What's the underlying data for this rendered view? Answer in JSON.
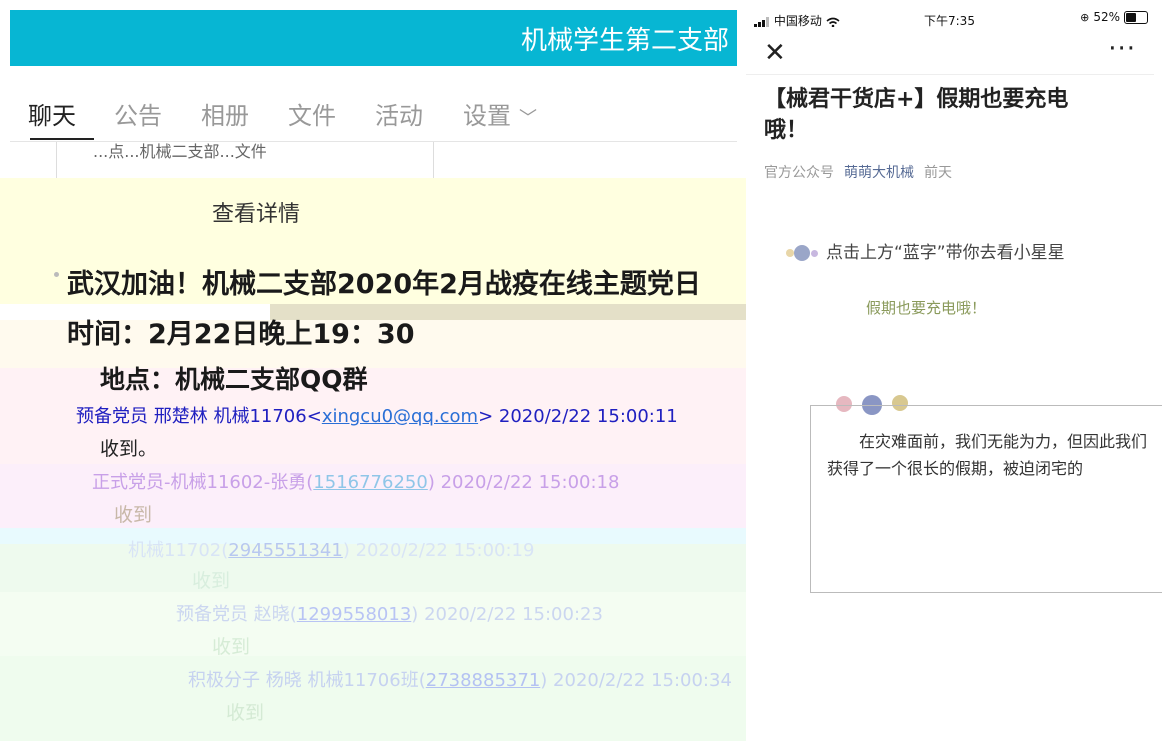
{
  "group": {
    "name": "机械学生第二支部",
    "tabs": [
      {
        "label": "聊天",
        "active": true
      },
      {
        "label": "公告",
        "active": false
      },
      {
        "label": "相册",
        "active": false
      },
      {
        "label": "文件",
        "active": false
      },
      {
        "label": "活动",
        "active": false
      },
      {
        "label": "设置",
        "active": false
      }
    ]
  },
  "doc_card": {
    "fragment_text": "...点...机械二支部...文件",
    "view_details": "查看详情"
  },
  "announcement": {
    "title": "武汉加油！机械二支部2020年2月战疫在线主题党日",
    "time": "时间：2月22日晚上19：30",
    "place": "地点：机械二支部QQ群"
  },
  "messages": [
    {
      "role": "预备党员",
      "name": "邢楚林 机械11706",
      "contact_prefix": "<",
      "contact": "xingcu0@qq.com",
      "contact_suffix": ">",
      "time": "2020/2/22 15:00:11",
      "body": "收到。"
    },
    {
      "role": "正式党员",
      "name": "机械11602-张勇",
      "contact_prefix": "(",
      "contact": "1516776250",
      "contact_suffix": ")",
      "time": "2020/2/22 15:00:18",
      "body": "收到"
    },
    {
      "role": "",
      "name": "机械11702",
      "contact_prefix": "(",
      "contact": "2945551341",
      "contact_suffix": ")",
      "time": "2020/2/22 15:00:19",
      "body": "收到"
    },
    {
      "role": "预备党员",
      "name": "赵晓",
      "contact_prefix": "(",
      "contact": "1299558013",
      "contact_suffix": ")",
      "time": "2020/2/22 15:00:23",
      "body": "收到"
    },
    {
      "role": "积极分子",
      "name": "杨晓 机械11706班",
      "contact_prefix": "(",
      "contact": "2738885371",
      "contact_suffix": ")",
      "time": "2020/2/22 15:00:34",
      "body": "收到"
    }
  ],
  "phone": {
    "carrier": "中国移动",
    "time": "下午7:35",
    "battery": "52%",
    "close_icon": "close-icon",
    "more_icon": "more-icon",
    "article_title": "【械君干货店+】假期也要充电哦！",
    "meta_source": "官方公众号",
    "meta_account": "萌萌大机械",
    "meta_date": "前天",
    "blue_word_line": "点击上方“蓝字”带你去看小星星",
    "subtitle": "假期也要充电哦！",
    "paragraph": "在灾难面前，我们无能为力，但因此我们获得了一个很长的假期，被迫闭宅的"
  },
  "colors": {
    "header_bg": "#07b6d3",
    "link": "#2a6fd6",
    "name_blue": "#2020c0",
    "account_blue": "#576b95"
  }
}
